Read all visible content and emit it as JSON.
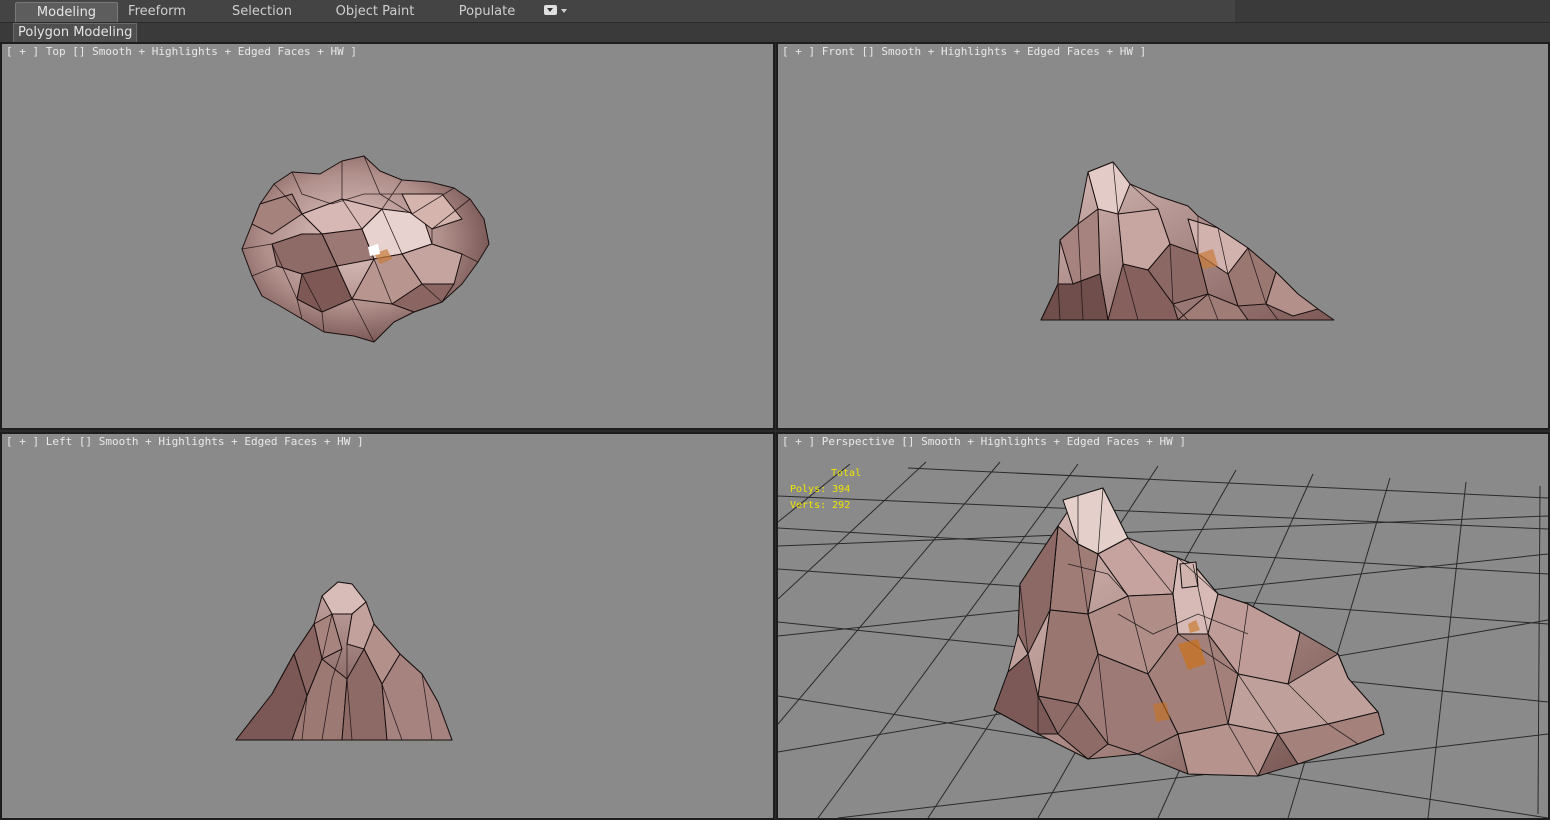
{
  "tabs": [
    "Modeling",
    "Freeform",
    "Selection",
    "Object Paint",
    "Populate"
  ],
  "active_tab": "Modeling",
  "ribbon_label": "Polygon Modeling",
  "viewports": {
    "top": {
      "label": "[ + ] Top [] Smooth + Highlights + Edged Faces + HW ]"
    },
    "front": {
      "label": "[ + ] Front [] Smooth + Highlights + Edged Faces + HW ]"
    },
    "left": {
      "label": "[ + ] Left [] Smooth + Highlights + Edged Faces + HW ]"
    },
    "perspective": {
      "label": "[ + ] Perspective [] Smooth + Highlights + Edged Faces + HW ]"
    }
  },
  "stats": {
    "header": "Total",
    "polys_label": "Polys:",
    "polys_value": "394",
    "verts_label": "Verts:",
    "verts_value": "292"
  },
  "colors": {
    "viewport_bg": "#8a8a8a",
    "rock_light": "#c9a8a5",
    "rock_dark": "#6e4c4a",
    "stat_text": "#f0e400",
    "grid": "#2a2a2a"
  }
}
